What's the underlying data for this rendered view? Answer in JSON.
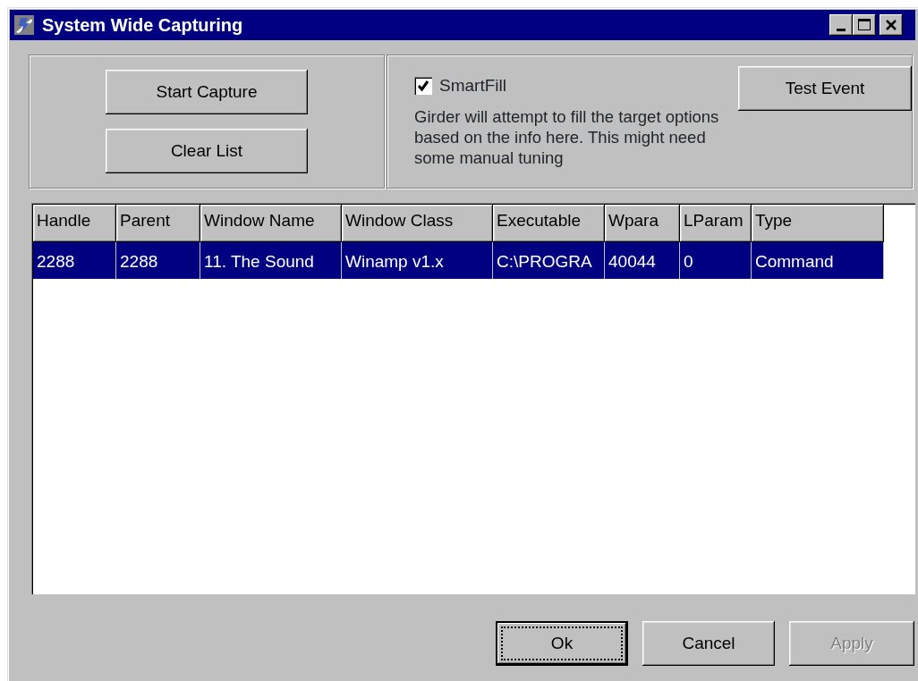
{
  "window": {
    "title": "System Wide Capturing"
  },
  "capture_buttons": [
    {
      "label": "Start Capture"
    },
    {
      "label": "Clear List"
    }
  ],
  "smartfill": {
    "label": "SmartFill",
    "checked": true,
    "description": "Girder will attempt to fill the target options based on the info here. This might need some manual tuning"
  },
  "test_button": {
    "label": "Test Event"
  },
  "table": {
    "columns": [
      "Handle",
      "Parent",
      "Window Name",
      "Window Class",
      "Executable",
      "Wpara",
      "LParam",
      "Type"
    ],
    "rows": [
      {
        "selected": true,
        "cells": [
          "2288",
          "2288",
          "11. The Sound",
          "Winamp v1.x",
          "C:\\PROGRA",
          "40044",
          "0",
          "Command"
        ]
      }
    ]
  },
  "buttons": [
    {
      "label": "Ok",
      "focused": true,
      "disabled": false
    },
    {
      "label": "Cancel",
      "focused": false,
      "disabled": false
    },
    {
      "label": "Apply",
      "focused": false,
      "disabled": true
    }
  ]
}
